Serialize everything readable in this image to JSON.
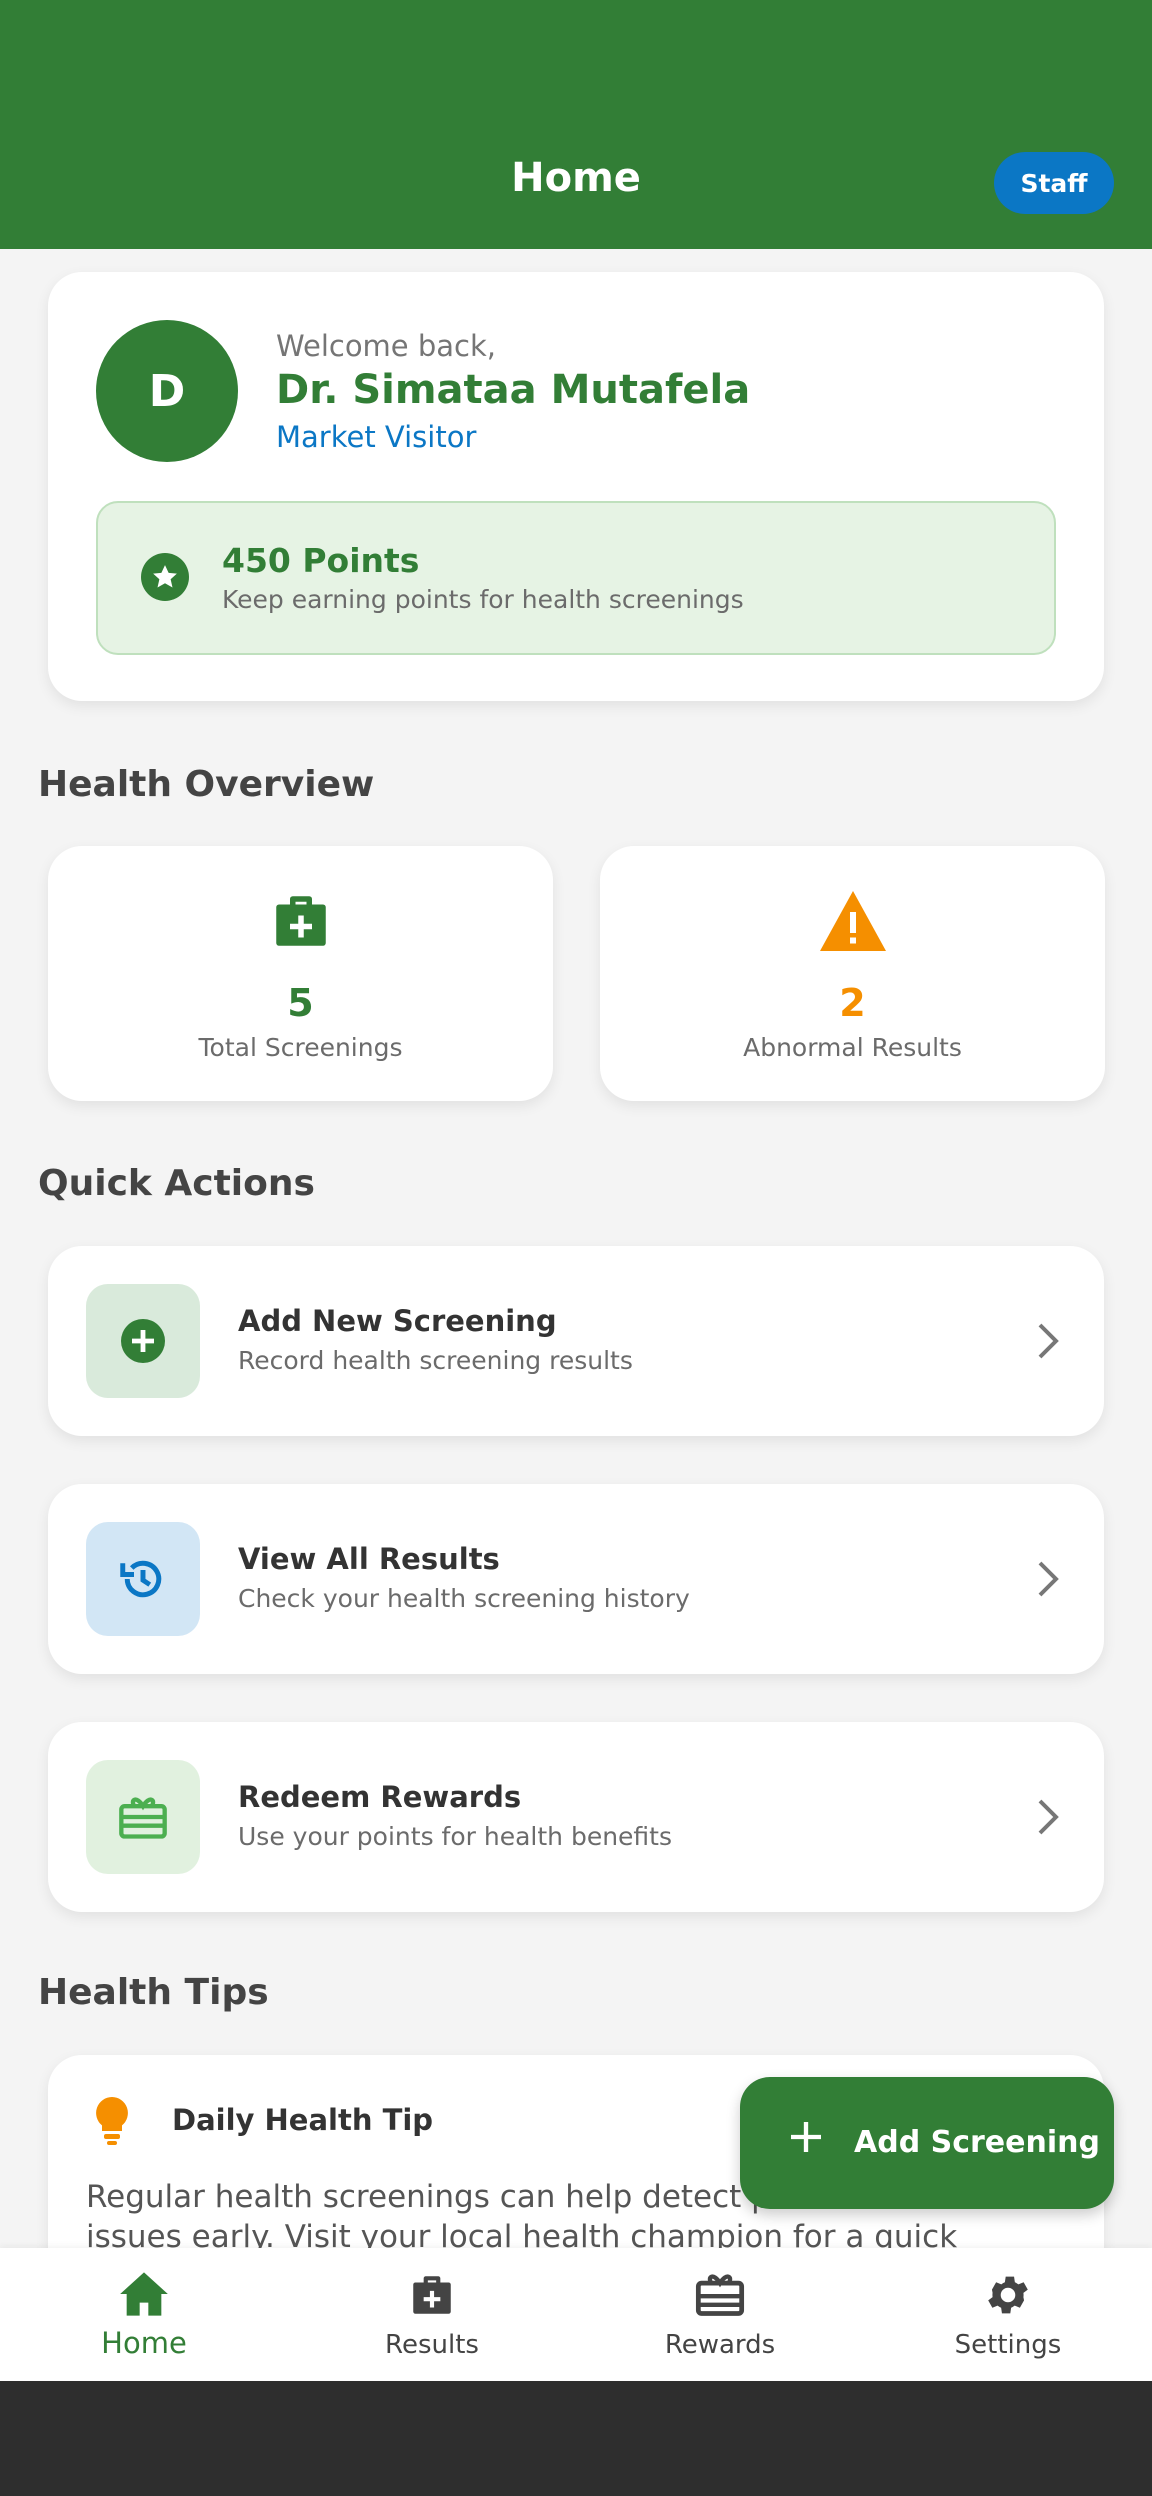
{
  "colors": {
    "primary": "#327e36",
    "accent_blue": "#0b77c5",
    "warning": "#f58f00"
  },
  "appbar": {
    "title": "Home",
    "staff_label": "Staff"
  },
  "profile": {
    "initial": "D",
    "welcome": "Welcome back,",
    "name": "Dr. Simataa Mutafela",
    "role": "Market Visitor"
  },
  "points": {
    "title": "450 Points",
    "subtitle": "Keep earning points for health screenings",
    "icon": "star-icon"
  },
  "overview": {
    "title": "Health Overview",
    "stats": [
      {
        "value": "5",
        "label": "Total Screenings",
        "icon": "medical-kit-icon"
      },
      {
        "value": "2",
        "label": "Abnormal Results",
        "icon": "warning-icon"
      }
    ]
  },
  "quick_actions": {
    "title": "Quick Actions",
    "items": [
      {
        "title": "Add New Screening",
        "subtitle": "Record health screening results",
        "icon": "add-circle-icon"
      },
      {
        "title": "View All Results",
        "subtitle": "Check your health screening history",
        "icon": "history-icon"
      },
      {
        "title": "Redeem Rewards",
        "subtitle": "Use your points for health benefits",
        "icon": "gift-card-icon"
      }
    ]
  },
  "tips": {
    "title": "Health Tips",
    "card_title": "Daily Health Tip",
    "text": "Regular health screenings can help detect potential health issues early. Visit your local health champion for a quick check-up!"
  },
  "fab": {
    "label": "Add Screening"
  },
  "nav": [
    {
      "label": "Home",
      "icon": "home-icon",
      "active": true
    },
    {
      "label": "Results",
      "icon": "medical-kit-icon"
    },
    {
      "label": "Rewards",
      "icon": "rewards-icon"
    },
    {
      "label": "Settings",
      "icon": "settings-gear-icon"
    }
  ]
}
